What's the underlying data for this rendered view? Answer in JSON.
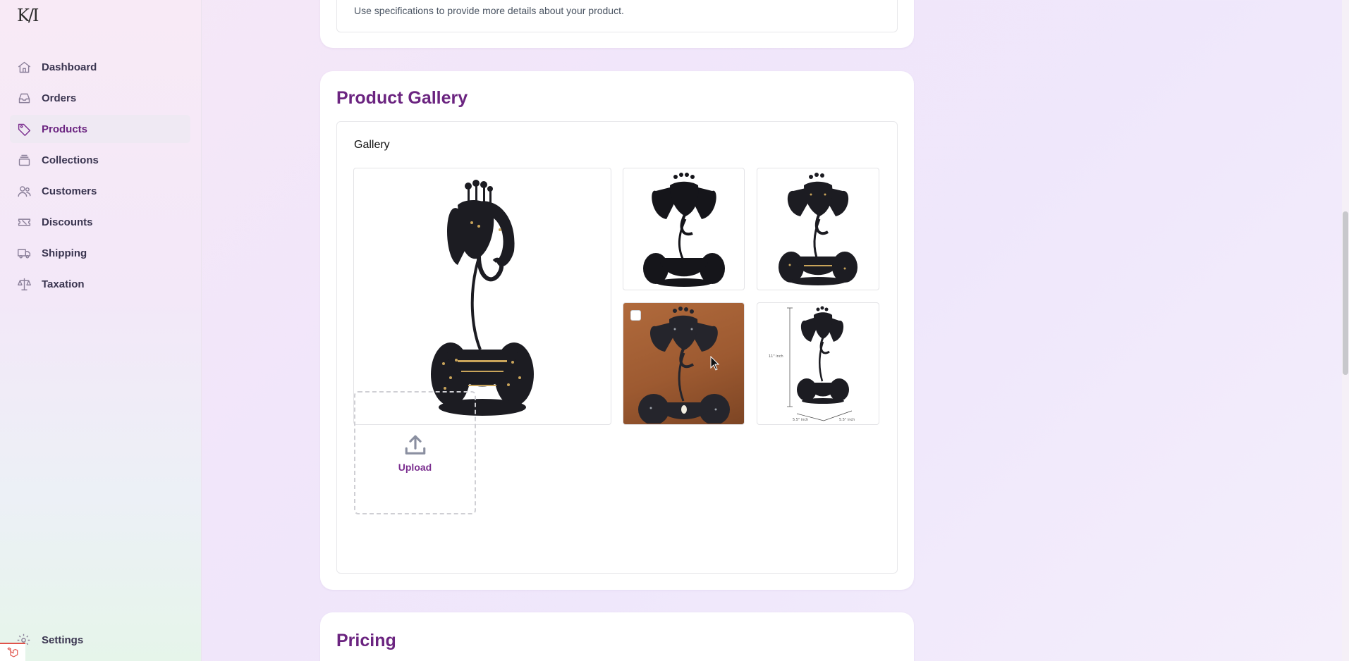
{
  "sidebar": {
    "logo": "K/I",
    "items": [
      {
        "label": "Dashboard",
        "icon": "home-icon",
        "active": false
      },
      {
        "label": "Orders",
        "icon": "inbox-icon",
        "active": false
      },
      {
        "label": "Products",
        "icon": "tag-icon",
        "active": true
      },
      {
        "label": "Collections",
        "icon": "stack-icon",
        "active": false
      },
      {
        "label": "Customers",
        "icon": "users-icon",
        "active": false
      },
      {
        "label": "Discounts",
        "icon": "ticket-icon",
        "active": false
      },
      {
        "label": "Shipping",
        "icon": "truck-icon",
        "active": false
      },
      {
        "label": "Taxation",
        "icon": "scale-icon",
        "active": false
      }
    ],
    "settings_label": "Settings"
  },
  "specifications": {
    "hint": "Use specifications to provide more details about your product."
  },
  "gallery": {
    "title": "Product Gallery",
    "label": "Gallery",
    "upload_label": "Upload",
    "images": [
      {
        "alt": "elephant-candle-holder-front"
      },
      {
        "alt": "elephant-candle-holder-silhouette"
      },
      {
        "alt": "elephant-candle-holder-detail"
      },
      {
        "alt": "elephant-candle-holder-lifestyle"
      },
      {
        "alt": "elephant-candle-holder-dimensions"
      }
    ],
    "dimension_labels": [
      "11\" inch",
      "5.5\" inch",
      "5.5\" inch"
    ]
  },
  "pricing": {
    "title": "Pricing"
  },
  "colors": {
    "accent": "#6b2480",
    "active_nav_bg": "#efe9f3"
  }
}
